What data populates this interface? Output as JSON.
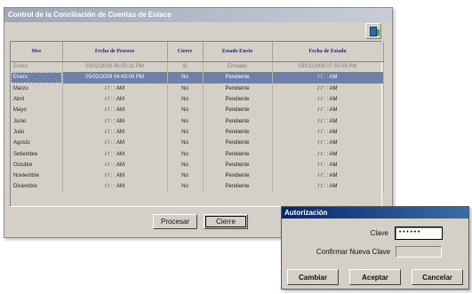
{
  "main": {
    "title": "Control de la Conciliación de Cuentas de Enlace",
    "columns": [
      "Mes",
      "Fecha de Proceso",
      "Cierre",
      "Estado Envio",
      "Fecha de Estado"
    ],
    "rows": [
      [
        "Enero",
        "03/02/2009 06:55:31 PM",
        "Si",
        "Enviado",
        "03/02/2009 07:55:59 PM"
      ],
      [
        "Enero",
        "05/02/2009 04:43:09 PM",
        "No",
        "Pendiente",
        "/ /      : : AM"
      ],
      [
        "Marzo",
        "/ /      : : AM",
        "No",
        "Pendiente",
        "/ /      : : AM"
      ],
      [
        "Abril",
        "/ /      : : AM",
        "No",
        "Pendiente",
        "/ /      : : AM"
      ],
      [
        "Mayo",
        "/ /      : : AM",
        "No",
        "Pendiente",
        "/ /      : : AM"
      ],
      [
        "Junio",
        "/ /      : : AM",
        "No",
        "Pendiente",
        "/ /      : : AM"
      ],
      [
        "Julio",
        "/ /      : : AM",
        "No",
        "Pendiente",
        "/ /      : : AM"
      ],
      [
        "Agosto",
        "/ /      : : AM",
        "No",
        "Pendiente",
        "/ /      : : AM"
      ],
      [
        "Setiembre",
        "/ /      : : AM",
        "No",
        "Pendiente",
        "/ /      : : AM"
      ],
      [
        "Octubre",
        "/ /      : : AM",
        "No",
        "Pendiente",
        "/ /      : : AM"
      ],
      [
        "Noviembre",
        "/ /      : : AM",
        "No",
        "Pendiente",
        "/ /      : : AM"
      ],
      [
        "Diciembre",
        "/ /      : : AM",
        "No",
        "Pendiente",
        "/ /      : : AM"
      ]
    ],
    "buttons": {
      "procesar": "Procesar",
      "cierre": "Cierre"
    }
  },
  "auth": {
    "title": "Autorización",
    "clave_label": "Clave",
    "clave_value": "••••••",
    "confirm_label": "Confirmar Nueva Clave",
    "confirm_value": "",
    "buttons": {
      "cambiar": "Cambiar",
      "aceptar": "Aceptar",
      "cancelar": "Cancelar"
    }
  },
  "colors": {
    "selection": "#6f7fa8",
    "header_text": "#1f2a6e",
    "window_bg": "#d4d0c8"
  }
}
